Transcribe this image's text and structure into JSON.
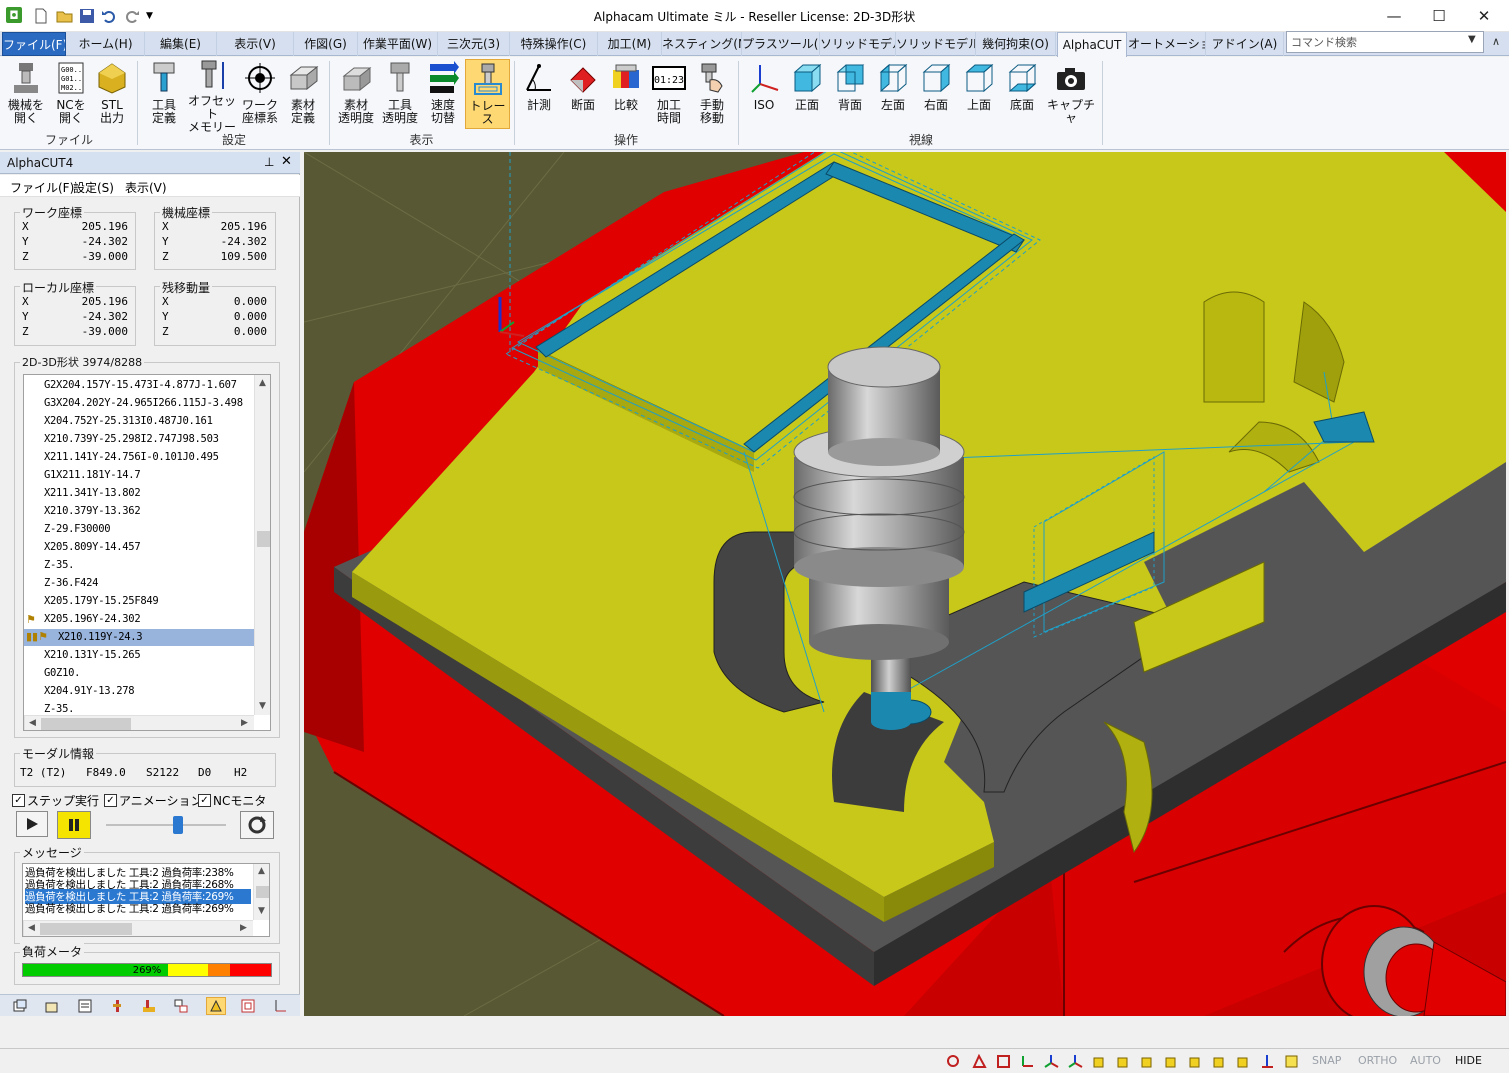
{
  "window": {
    "title": "Alphacam Ultimate ミル - Reseller License: 2D-3D形状"
  },
  "tabs": [
    {
      "label": "ファイル(F)"
    },
    {
      "label": "ホーム(H)"
    },
    {
      "label": "編集(E)"
    },
    {
      "label": "表示(V)"
    },
    {
      "label": "作図(G)"
    },
    {
      "label": "作業平面(W)"
    },
    {
      "label": "三次元(3)"
    },
    {
      "label": "特殊操作(C)"
    },
    {
      "label": "加工(M)"
    },
    {
      "label": "ネスティング(N)"
    },
    {
      "label": "プラスツール(P)"
    },
    {
      "label": "ソリッドモデル"
    },
    {
      "label": "ソリッドモデル"
    },
    {
      "label": "幾何拘束(O)"
    },
    {
      "label": "AlphaCUT"
    },
    {
      "label": "オートメーション"
    },
    {
      "label": "アドイン(A)"
    }
  ],
  "command_search": {
    "placeholder": "コマンド検索"
  },
  "ribbon": {
    "buttons": [
      {
        "l1": "機械を",
        "l2": "開く"
      },
      {
        "l1": "NCを",
        "l2": "開く"
      },
      {
        "l1": "STL",
        "l2": "出力"
      },
      {
        "l1": "工具",
        "l2": "定義"
      },
      {
        "l1": "オフセット",
        "l2": "メモリー"
      },
      {
        "l1": "ワーク",
        "l2": "座標系"
      },
      {
        "l1": "素材",
        "l2": "定義"
      },
      {
        "l1": "素材",
        "l2": "透明度"
      },
      {
        "l1": "工具",
        "l2": "透明度"
      },
      {
        "l1": "速度",
        "l2": "切替"
      },
      {
        "l1": "トレース",
        "l2": ""
      },
      {
        "l1": "計測",
        "l2": ""
      },
      {
        "l1": "断面",
        "l2": ""
      },
      {
        "l1": "比較",
        "l2": ""
      },
      {
        "l1": "加工",
        "l2": "時間"
      },
      {
        "l1": "手動",
        "l2": "移動"
      },
      {
        "l1": "ISO",
        "l2": ""
      },
      {
        "l1": "正面",
        "l2": ""
      },
      {
        "l1": "背面",
        "l2": ""
      },
      {
        "l1": "左面",
        "l2": ""
      },
      {
        "l1": "右面",
        "l2": ""
      },
      {
        "l1": "上面",
        "l2": ""
      },
      {
        "l1": "底面",
        "l2": ""
      },
      {
        "l1": "キャプチャ",
        "l2": ""
      }
    ],
    "groups": [
      "ファイル",
      "設定",
      "表示",
      "操作",
      "視線"
    ],
    "timer_icon_text": "01:23",
    "nc_icon_text": [
      "G00..",
      "G01..",
      "M02.."
    ]
  },
  "panel": {
    "title": "AlphaCUT4",
    "menu": [
      "ファイル(F)",
      "設定(S)",
      "表示(V)"
    ],
    "work_coords": {
      "title": "ワーク座標",
      "rows": [
        {
          "axis": "X",
          "value": "205.196"
        },
        {
          "axis": "Y",
          "value": "-24.302"
        },
        {
          "axis": "Z",
          "value": "-39.000"
        }
      ]
    },
    "machine_coords": {
      "title": "機械座標",
      "rows": [
        {
          "axis": "X",
          "value": "205.196"
        },
        {
          "axis": "Y",
          "value": "-24.302"
        },
        {
          "axis": "Z",
          "value": "109.500"
        }
      ]
    },
    "local_coords": {
      "title": "ローカル座標",
      "rows": [
        {
          "axis": "X",
          "value": "205.196"
        },
        {
          "axis": "Y",
          "value": "-24.302"
        },
        {
          "axis": "Z",
          "value": "-39.000"
        }
      ]
    },
    "remaining": {
      "title": "残移動量",
      "rows": [
        {
          "axis": "X",
          "value": "0.000"
        },
        {
          "axis": "Y",
          "value": "0.000"
        },
        {
          "axis": "Z",
          "value": "0.000"
        }
      ]
    },
    "program": {
      "title": "2D-3D形状 3974/8288",
      "lines": [
        "G2X204.157Y-15.473I-4.877J-1.607",
        "G3X204.202Y-24.965I266.115J-3.498",
        "X204.752Y-25.313I0.487J0.161",
        "X210.739Y-25.298I2.747J98.503",
        "X211.141Y-24.756I-0.101J0.495",
        "G1X211.181Y-14.7",
        "X211.341Y-13.802",
        "X210.379Y-13.362",
        "Z-29.F30000",
        "X205.809Y-14.457",
        "Z-35.",
        "Z-36.F424",
        "X205.179Y-15.25F849",
        "X205.196Y-24.302",
        "X210.119Y-24.3",
        "X210.131Y-15.265",
        "G0Z10.",
        "X204.91Y-13.278",
        "Z-35."
      ]
    },
    "modal": {
      "title": "モーダル情報",
      "values": [
        "T2 (T2)",
        "F849.0",
        "S2122",
        "D0",
        "H2"
      ]
    },
    "options": [
      {
        "label": "ステップ実行",
        "checked": true
      },
      {
        "label": "アニメーション",
        "checked": true
      },
      {
        "label": "NCモニタ",
        "checked": true
      }
    ],
    "speed_slider": 0.6,
    "messages": {
      "title": "メッセージ",
      "items": [
        "過負荷を検出しました 工具:2 過負荷率:238%",
        "過負荷を検出しました 工具:2 過負荷率:268%",
        "過負荷を検出しました 工具:2 過負荷率:269%",
        "過負荷を検出しました 工具:2 過負荷率:269%"
      ]
    },
    "load_meter": {
      "title": "負荷メータ",
      "label": "269%",
      "zones": [
        "#00cc00",
        "#ffff00",
        "#ff8000",
        "#ff0000"
      ]
    }
  },
  "status": {
    "toggles": [
      "SNAP",
      "ORTHO",
      "AUTO",
      "HIDE"
    ]
  },
  "colors": {
    "fixture": "#e00000",
    "workpiece": "#c8c81a",
    "toolpath": "#1fa0c8",
    "file_tab": "#2a6ac0",
    "background": "#585834"
  }
}
